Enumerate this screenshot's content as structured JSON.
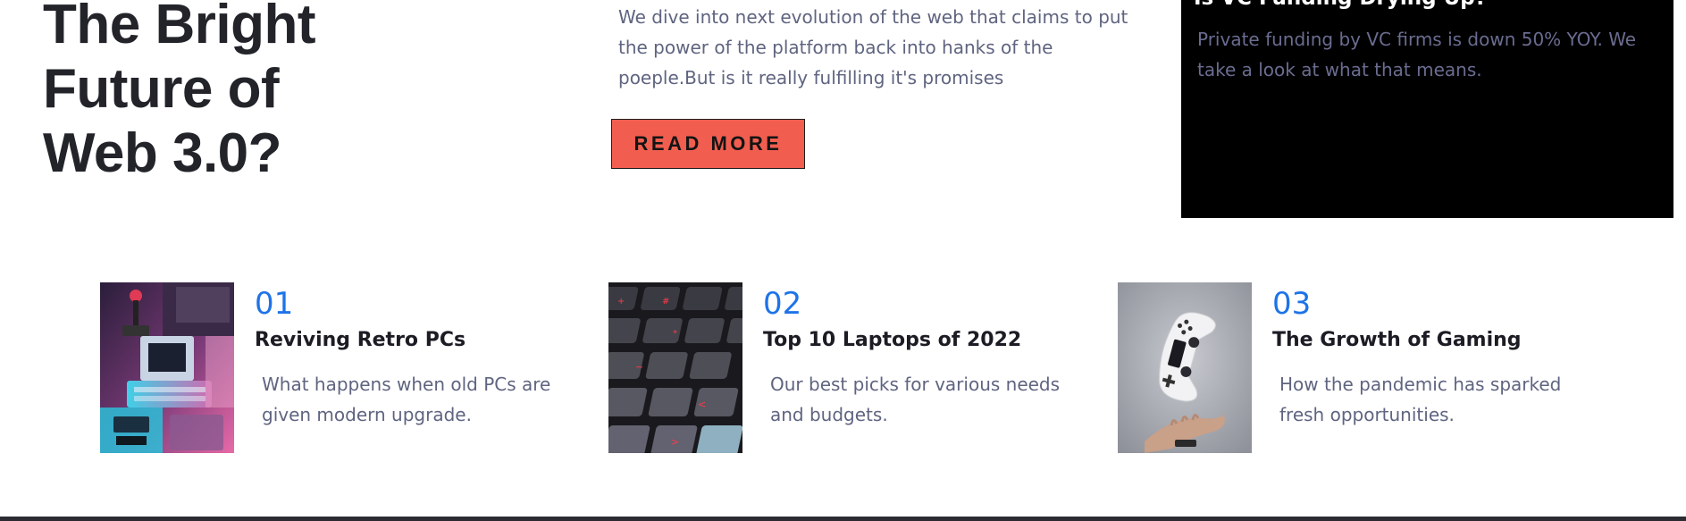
{
  "hero": {
    "headline": "The Bright Future of Web 3.0?",
    "intro": "We dive into next evolution of the web that claims to put the power of the platform back into hanks of the poeple.But is it really fulfilling it's promises",
    "cta_label": "READ MORE"
  },
  "side_card": {
    "title": "Is VC Funding Drying Up?",
    "text": "Private funding by VC firms is down 50% YOY. We take a look at what that means."
  },
  "articles": [
    {
      "number": "01",
      "title": "Reviving Retro PCs",
      "description": "What happens when old PCs are given modern upgrade.",
      "image_icon": "retro-computer-image"
    },
    {
      "number": "02",
      "title": "Top 10 Laptops of 2022",
      "description": "Our best picks for various needs and budgets.",
      "image_icon": "keyboard-image"
    },
    {
      "number": "03",
      "title": "The Growth of Gaming",
      "description": "How the pandemic has sparked fresh opportunities.",
      "image_icon": "gamepad-image"
    }
  ],
  "colors": {
    "accent_button": "#f15e4f",
    "number_blue": "#1e73e8",
    "dark_text": "#22242a",
    "muted_text": "#5f6480"
  }
}
